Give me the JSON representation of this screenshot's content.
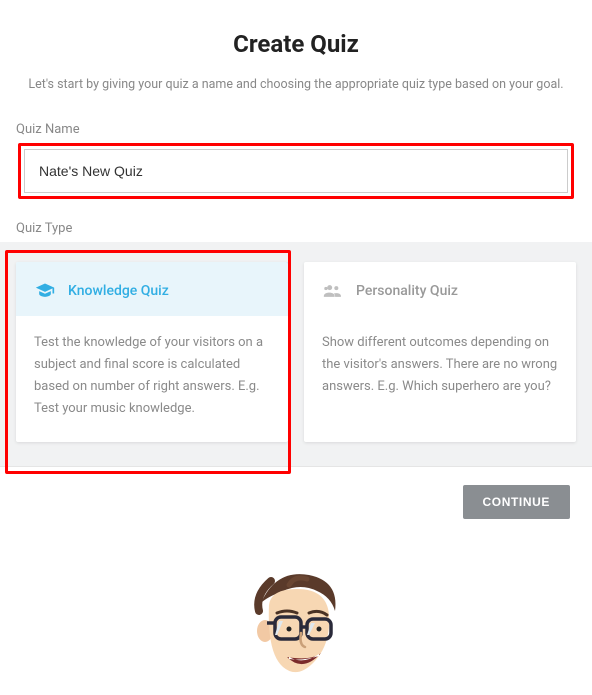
{
  "header": {
    "title": "Create Quiz",
    "subtitle": "Let's start by giving your quiz a name and choosing the appropriate quiz type based on your goal."
  },
  "quiz_name": {
    "label": "Quiz Name",
    "value": "Nate's New Quiz"
  },
  "quiz_type": {
    "label": "Quiz Type",
    "options": [
      {
        "title": "Knowledge Quiz",
        "icon": "graduation-cap-icon",
        "description": "Test the knowledge of your visitors on a subject and final score is calculated based on number of right answers. E.g. Test your music knowledge.",
        "selected": true
      },
      {
        "title": "Personality Quiz",
        "icon": "people-icon",
        "description": "Show different outcomes depending on the visitor's answers. There are no wrong answers. E.g. Which superhero are you?",
        "selected": false
      }
    ]
  },
  "actions": {
    "continue": "CONTINUE"
  },
  "colors": {
    "accent": "#31aee3",
    "highlight": "#ff0000",
    "muted_text": "#888888"
  }
}
